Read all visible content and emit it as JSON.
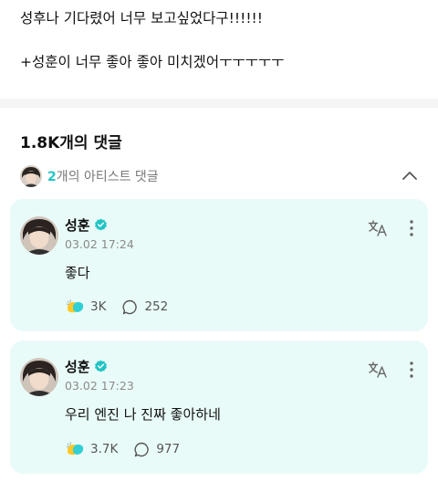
{
  "post": {
    "lines": [
      "성후나 기다렸어 너무 보고싶었다구!!!!!!",
      "+성훈이 너무 좋아 좋아 미치겠어ㅜㅜㅜㅜㅜ"
    ]
  },
  "comments_section": {
    "count_label": "1.8K개의 댓글",
    "artist_header": {
      "count": "2",
      "label": "개의 아티스트 댓글",
      "expanded": true
    }
  },
  "comments": [
    {
      "author": "성훈",
      "verified": true,
      "date": "03.02 17:24",
      "text": "좋다",
      "likes": "3K",
      "replies": "252"
    },
    {
      "author": "성훈",
      "verified": true,
      "date": "03.02 17:23",
      "text": "우리 엔진 나 진짜 좋아하네",
      "likes": "3.7K",
      "replies": "977"
    }
  ],
  "colors": {
    "accent": "#21c4c4",
    "card_background": "#e9fbf8",
    "divider": "#f5f5f5"
  },
  "icons": {
    "verified": "verified-badge-icon",
    "translate": "translate-icon",
    "more": "more-vertical-icon",
    "like": "cheer-hands-icon",
    "reply": "speech-bubble-icon",
    "collapse": "chevron-up-icon"
  }
}
